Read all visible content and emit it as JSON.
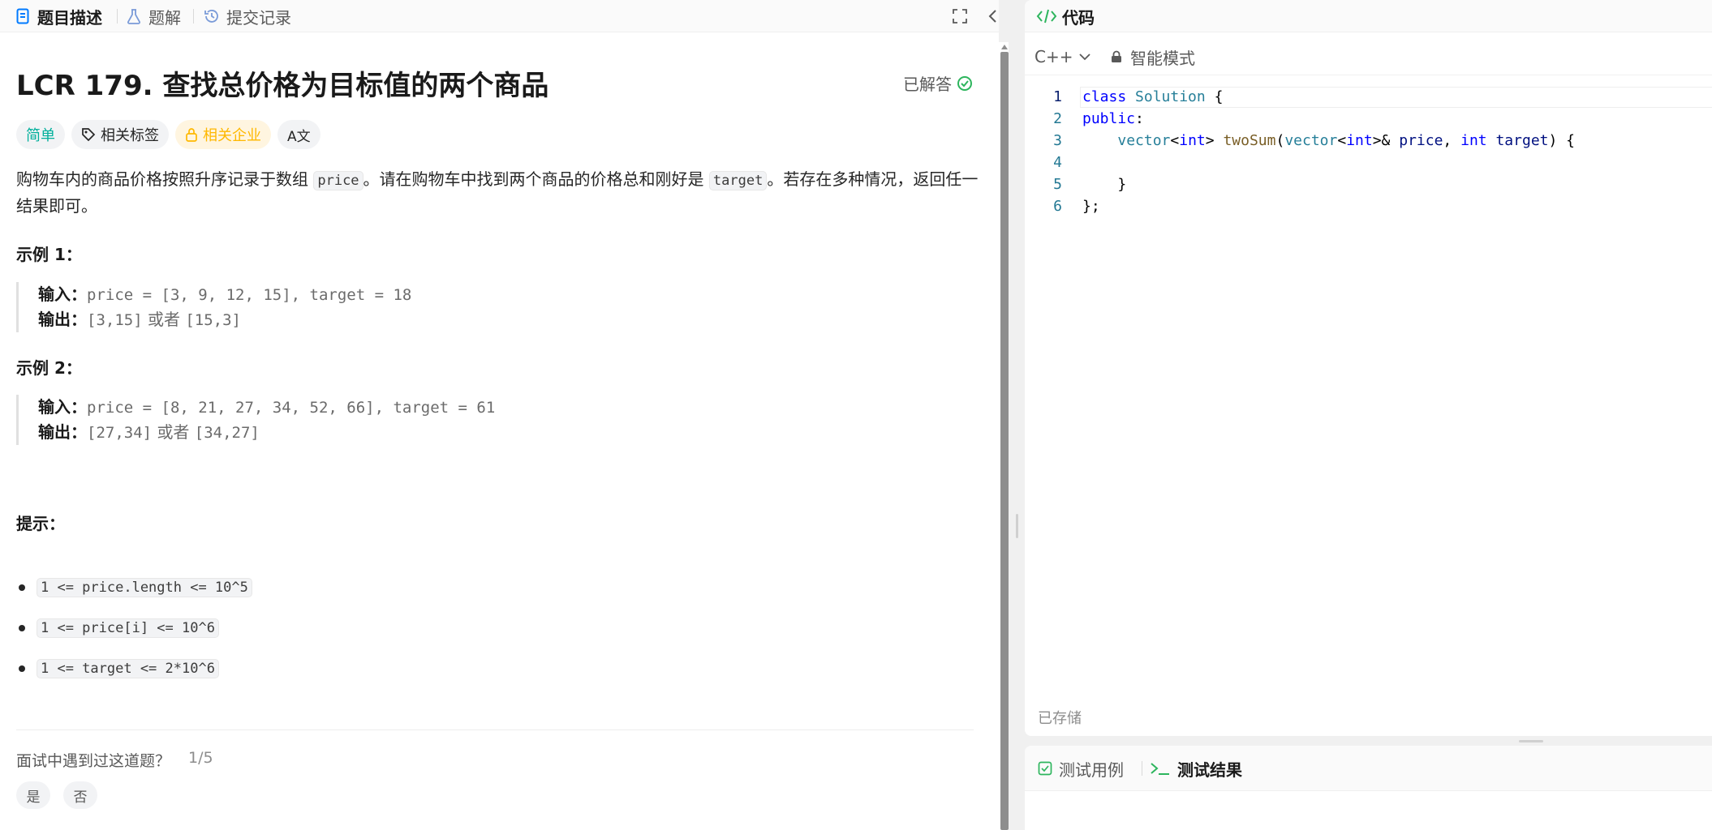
{
  "left_tabs": [
    {
      "label": "题目描述",
      "icon": "document-icon"
    },
    {
      "label": "题解",
      "icon": "flask-icon"
    },
    {
      "label": "提交记录",
      "icon": "history-icon"
    }
  ],
  "problem": {
    "title": "LCR 179. 查找总价格为目标值的两个商品",
    "status": "已解答",
    "tags": {
      "difficulty": "简单",
      "related_tags": "相关标签",
      "related_companies": "相关企业",
      "translate": "A文"
    },
    "description": {
      "part1": "购物车内的商品价格按照升序记录于数组 ",
      "code1": "price",
      "part2": "。请在购物车中找到两个商品的价格总和刚好是 ",
      "code2": "target",
      "part3": "。若存在多种情况，返回任一结果即可。"
    },
    "examples": [
      {
        "heading": "示例 1：",
        "input_label": "输入：",
        "input": "price = [3, 9, 12, 15], target = 18",
        "output_label": "输出：",
        "output_a": "[3,15]",
        "or": "或者",
        "output_b": "[15,3]"
      },
      {
        "heading": "示例 2：",
        "input_label": "输入：",
        "input": "price = [8, 21, 27, 34, 52, 66], target = 61",
        "output_label": "输出：",
        "output_a": "[27,34]",
        "or": "或者",
        "output_b": "[34,27]"
      }
    ],
    "hints_heading": "提示：",
    "constraints": [
      "1 <= price.length <= 10^5",
      "1 <= price[i] <= 10^6",
      "1 <= target <= 2*10^6"
    ],
    "interview": {
      "question": "面试中遇到过这道题？",
      "count": "1/5",
      "yes": "是",
      "no": "否"
    }
  },
  "code_panel": {
    "title": "代码",
    "language": "C++",
    "mode": "智能模式",
    "saved": "已存储",
    "line_numbers": [
      "1",
      "2",
      "3",
      "4",
      "5",
      "6"
    ]
  },
  "test_panel": {
    "tabs": [
      "测试用例",
      "测试结果"
    ]
  },
  "colors": {
    "accent": "#007aff",
    "easy": "#00af9b",
    "company": "#ffb800",
    "success": "#2db55d",
    "terminal": "#2db55d"
  }
}
